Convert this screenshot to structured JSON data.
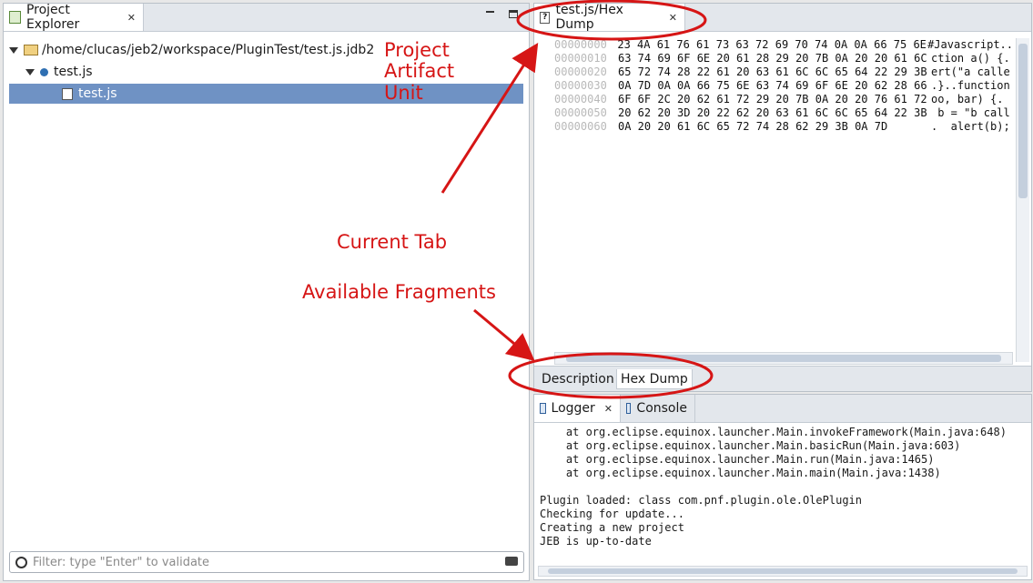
{
  "project_explorer": {
    "tab_label": "Project Explorer",
    "tree": [
      {
        "label": "/home/clucas/jeb2/workspace/PluginTest/test.js.jdb2"
      },
      {
        "label": "test.js"
      },
      {
        "label": "test.js"
      }
    ],
    "filter_placeholder": "Filter: type \"Enter\" to validate"
  },
  "annotations": {
    "project": "Project",
    "artifact": "Artifact",
    "unit": "Unit",
    "current_tab": "Current Tab",
    "available_fragments": "Available Fragments"
  },
  "editor": {
    "tab_label": "test.js/Hex Dump",
    "hex_rows": [
      {
        "offset": "00000000",
        "bytes": "23 4A 61 76 61 73 63 72 69 70 74 0A 0A 66 75 6E",
        "ascii": "#Javascript.."
      },
      {
        "offset": "00000010",
        "bytes": "63 74 69 6F 6E 20 61 28 29 20 7B 0A 20 20 61 6C",
        "ascii": "ction a() {."
      },
      {
        "offset": "00000020",
        "bytes": "65 72 74 28 22 61 20 63 61 6C 6C 65 64 22 29 3B",
        "ascii": "ert(\"a calle"
      },
      {
        "offset": "00000030",
        "bytes": "0A 7D 0A 0A 66 75 6E 63 74 69 6F 6E 20 62 28 66",
        "ascii": ".}..function"
      },
      {
        "offset": "00000040",
        "bytes": "6F 6F 2C 20 62 61 72 29 20 7B 0A 20 20 76 61 72",
        "ascii": "oo, bar) {."
      },
      {
        "offset": "00000050",
        "bytes": "20 62 20 3D 20 22 62 20 63 61 6C 6C 65 64 22 3B",
        "ascii": " b = \"b call"
      },
      {
        "offset": "00000060",
        "bytes": "0A 20 20 61 6C 65 72 74 28 62 29 3B 0A 7D",
        "ascii": ".  alert(b);"
      }
    ],
    "fragments": [
      "Description",
      "Hex Dump"
    ]
  },
  "logger": {
    "tabs": [
      "Logger",
      "Console"
    ],
    "lines": [
      "    at org.eclipse.equinox.launcher.Main.invokeFramework(Main.java:648)",
      "    at org.eclipse.equinox.launcher.Main.basicRun(Main.java:603)",
      "    at org.eclipse.equinox.launcher.Main.run(Main.java:1465)",
      "    at org.eclipse.equinox.launcher.Main.main(Main.java:1438)",
      "",
      "Plugin loaded: class com.pnf.plugin.ole.OlePlugin",
      "Checking for update...",
      "Creating a new project",
      "JEB is up-to-date"
    ]
  },
  "colors": {
    "annotation": "#d61515",
    "selection": "#6f92c4"
  }
}
